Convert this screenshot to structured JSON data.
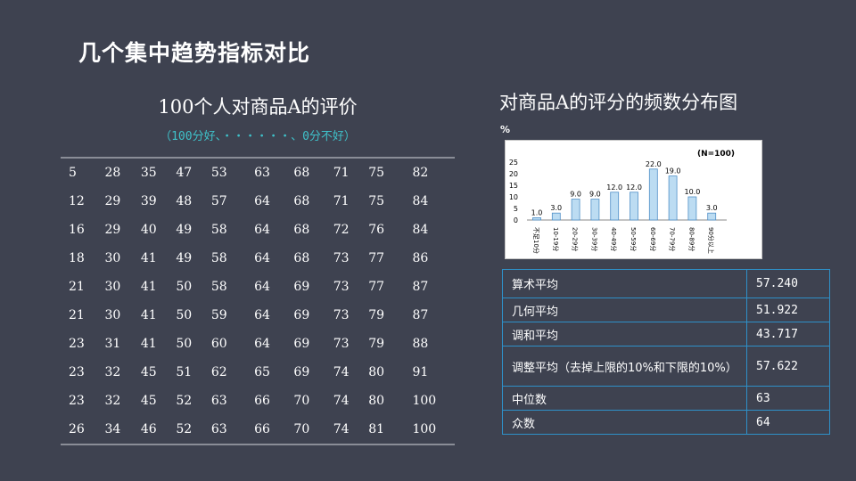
{
  "page": {
    "title": "几个集中趋势指标对比"
  },
  "left": {
    "title": "100个人对商品A的评价",
    "subtitle": "（100分好、・・・・・・、0分不好）",
    "rows": [
      [
        "5",
        "28",
        "35",
        "47",
        "53",
        "63",
        "68",
        "71",
        "75",
        "82"
      ],
      [
        "12",
        "29",
        "39",
        "48",
        "57",
        "64",
        "68",
        "71",
        "75",
        "84"
      ],
      [
        "16",
        "29",
        "40",
        "49",
        "58",
        "64",
        "68",
        "72",
        "76",
        "84"
      ],
      [
        "18",
        "30",
        "41",
        "49",
        "58",
        "64",
        "68",
        "73",
        "77",
        "86"
      ],
      [
        "21",
        "30",
        "41",
        "50",
        "58",
        "64",
        "69",
        "73",
        "77",
        "87"
      ],
      [
        "21",
        "30",
        "41",
        "50",
        "59",
        "64",
        "69",
        "73",
        "79",
        "87"
      ],
      [
        "23",
        "31",
        "41",
        "50",
        "60",
        "64",
        "69",
        "73",
        "79",
        "88"
      ],
      [
        "23",
        "32",
        "45",
        "51",
        "62",
        "65",
        "69",
        "74",
        "80",
        "91"
      ],
      [
        "23",
        "32",
        "45",
        "52",
        "63",
        "66",
        "70",
        "74",
        "80",
        "100"
      ],
      [
        "26",
        "34",
        "46",
        "52",
        "63",
        "66",
        "70",
        "74",
        "81",
        "100"
      ]
    ]
  },
  "right": {
    "title": "对商品A的评分的频数分布图",
    "stats": [
      {
        "label": "算术平均",
        "value": "57.240"
      },
      {
        "label": "几何平均",
        "value": "51.922"
      },
      {
        "label": "调和平均",
        "value": "43.717"
      },
      {
        "label": "调整平均（去掉上限的10%和下限的10%）",
        "value": "57.622"
      },
      {
        "label": "中位数",
        "value": "63"
      },
      {
        "label": "众数",
        "value": "64"
      }
    ]
  },
  "chart_data": {
    "type": "bar",
    "ylabel": "%",
    "annotation": "(N=100)",
    "ylim": [
      0,
      25
    ],
    "yticks": [
      0,
      5,
      10,
      15,
      20,
      25
    ],
    "categories": [
      "不足10分",
      "10-19分",
      "20-29分",
      "30-39分",
      "40-49分",
      "50-59分",
      "60-69分",
      "70-79分",
      "80-89分",
      "90分以上"
    ],
    "values": [
      1.0,
      3.0,
      9.0,
      9.0,
      12.0,
      12.0,
      22.0,
      19.0,
      10.0,
      3.0
    ],
    "value_labels": [
      "1.0",
      "3.0",
      "9.0",
      "9.0",
      "12.0",
      "12.0",
      "22.0",
      "19.0",
      "10.0",
      "3.0"
    ],
    "grid": false,
    "colors": {
      "bar_fill": "#bcdcf2",
      "bar_stroke": "#4f8fc7",
      "text": "#000000"
    }
  }
}
